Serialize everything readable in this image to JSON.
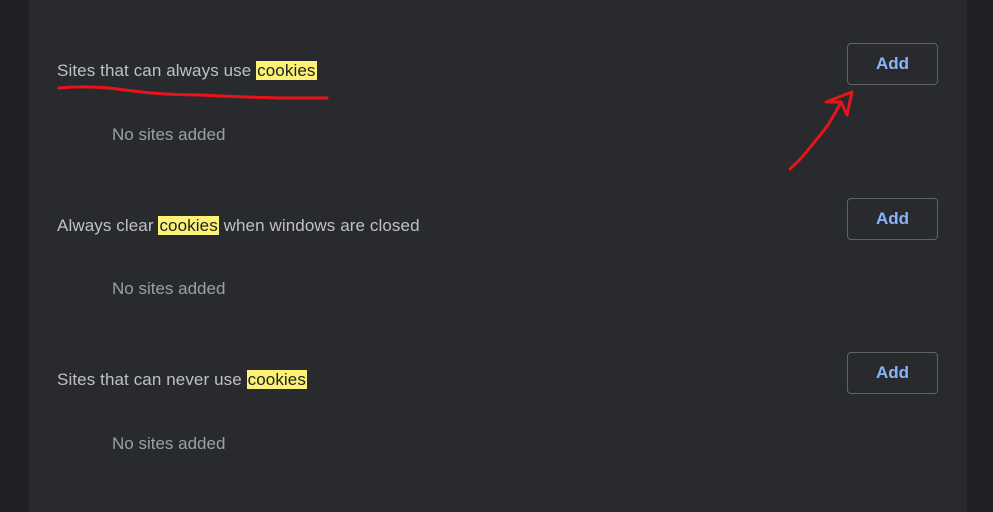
{
  "sections": [
    {
      "title_before": "Sites that can always use ",
      "title_highlight": "cookies",
      "title_after": "",
      "empty_text": "No sites added",
      "add_label": "Add"
    },
    {
      "title_before": "Always clear ",
      "title_highlight": "cookies",
      "title_after": " when windows are closed",
      "empty_text": "No sites added",
      "add_label": "Add"
    },
    {
      "title_before": "Sites that can never use ",
      "title_highlight": "cookies",
      "title_after": "",
      "empty_text": "No sites added",
      "add_label": "Add"
    }
  ],
  "colors": {
    "page_bg": "#202124",
    "card_bg": "#292a2d",
    "title_text": "#bdc1c6",
    "muted_text": "#9aa0a6",
    "button_text": "#8ab4f8",
    "button_border": "#5f6368",
    "highlight": "#fff176",
    "annotation": "#e8141c"
  },
  "annotations": [
    {
      "kind": "underline",
      "target": "Sites that can always use cookies"
    },
    {
      "kind": "arrow",
      "target": "Add"
    }
  ]
}
